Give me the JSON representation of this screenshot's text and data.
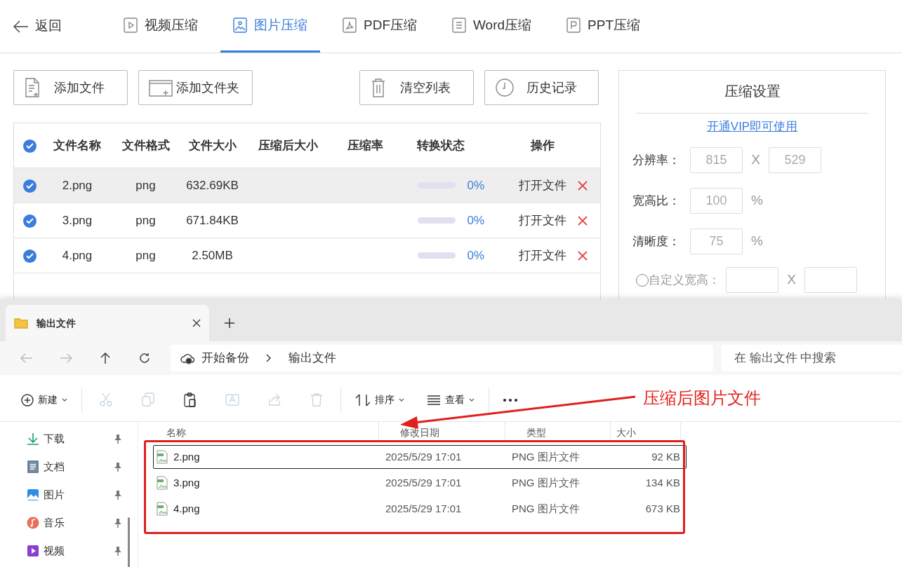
{
  "app": {
    "back": "返回",
    "tabs": [
      {
        "label": "视频压缩",
        "kind": "video",
        "selected": false
      },
      {
        "label": "图片压缩",
        "kind": "image",
        "selected": true
      },
      {
        "label": "PDF压缩",
        "kind": "pdf",
        "selected": false
      },
      {
        "label": "Word压缩",
        "kind": "word",
        "selected": false
      },
      {
        "label": "PPT压缩",
        "kind": "ppt",
        "selected": false
      }
    ],
    "toolbar": [
      {
        "label": "添加文件",
        "kind": "file"
      },
      {
        "label": "添加文件夹",
        "kind": "folder"
      },
      {
        "label": "清空列表",
        "kind": "trash"
      },
      {
        "label": "历史记录",
        "kind": "clock"
      }
    ],
    "table": {
      "all_checked": true,
      "columns": [
        "文件名称",
        "文件格式",
        "文件大小",
        "压缩后大小",
        "压缩率",
        "转换状态",
        "操作"
      ],
      "rows": [
        {
          "checked": true,
          "highlighted": true,
          "name": "2.png",
          "format": "png",
          "size": "632.69KB",
          "level": 0,
          "reading": "0%",
          "action": "打开文件"
        },
        {
          "checked": true,
          "highlighted": false,
          "name": "3.png",
          "format": "png",
          "size": "671.84KB",
          "level": 0,
          "reading": "0%",
          "action": "打开文件"
        },
        {
          "checked": true,
          "highlighted": false,
          "name": "4.png",
          "format": "png",
          "size": "2.50MB",
          "level": 0,
          "reading": "0%",
          "action": "打开文件"
        }
      ]
    },
    "settings": {
      "title": "压缩设置",
      "vip_link": "开通VIP即可使用",
      "fields": [
        {
          "kind": "pair",
          "label": "分辨率：",
          "values": [
            "815",
            "529"
          ],
          "separator": "X"
        },
        {
          "kind": "single",
          "label": "宽高比：",
          "values": [
            "100"
          ],
          "unit": "%"
        },
        {
          "kind": "single",
          "label": "清晰度：",
          "values": [
            "75"
          ],
          "unit": "%"
        },
        {
          "kind": "radio_pair",
          "label": "自定义宽高：",
          "selected": false,
          "separator": "X"
        }
      ]
    }
  },
  "explorer": {
    "tabs": [
      {
        "label": "输出文件",
        "selected": true
      }
    ],
    "breadcrumb": [
      "开始备份",
      "输出文件"
    ],
    "search": {
      "placeholder": "在 输出文件 中搜索"
    },
    "commands": [
      {
        "kind": "new",
        "label": "新建",
        "disabled": false
      },
      {
        "kind": "cut",
        "disabled": true
      },
      {
        "kind": "copy",
        "disabled": true
      },
      {
        "kind": "paste",
        "disabled": false
      },
      {
        "kind": "rename",
        "disabled": true
      },
      {
        "kind": "share",
        "disabled": true
      },
      {
        "kind": "delete",
        "disabled": true
      },
      {
        "kind": "sort",
        "label": "排序",
        "disabled": false
      },
      {
        "kind": "view",
        "label": "查看",
        "disabled": false
      },
      {
        "kind": "more",
        "disabled": false
      }
    ],
    "sidebar": [
      {
        "kind": "download",
        "label": "下载"
      },
      {
        "kind": "documents",
        "label": "文档"
      },
      {
        "kind": "pictures",
        "label": "图片"
      },
      {
        "kind": "music",
        "label": "音乐"
      },
      {
        "kind": "videos",
        "label": "视频"
      }
    ],
    "columns": [
      "名称",
      "修改日期",
      "类型",
      "大小"
    ],
    "files": [
      {
        "name": "2.png",
        "modified": "2025/5/29 17:01",
        "type": "PNG 图片文件",
        "size": "92 KB",
        "focused": true
      },
      {
        "name": "3.png",
        "modified": "2025/5/29 17:01",
        "type": "PNG 图片文件",
        "size": "134 KB",
        "focused": false
      },
      {
        "name": "4.png",
        "modified": "2025/5/29 17:01",
        "type": "PNG 图片文件",
        "size": "673 KB",
        "focused": false
      }
    ]
  },
  "annotation": {
    "text": "压缩后图片文件"
  }
}
